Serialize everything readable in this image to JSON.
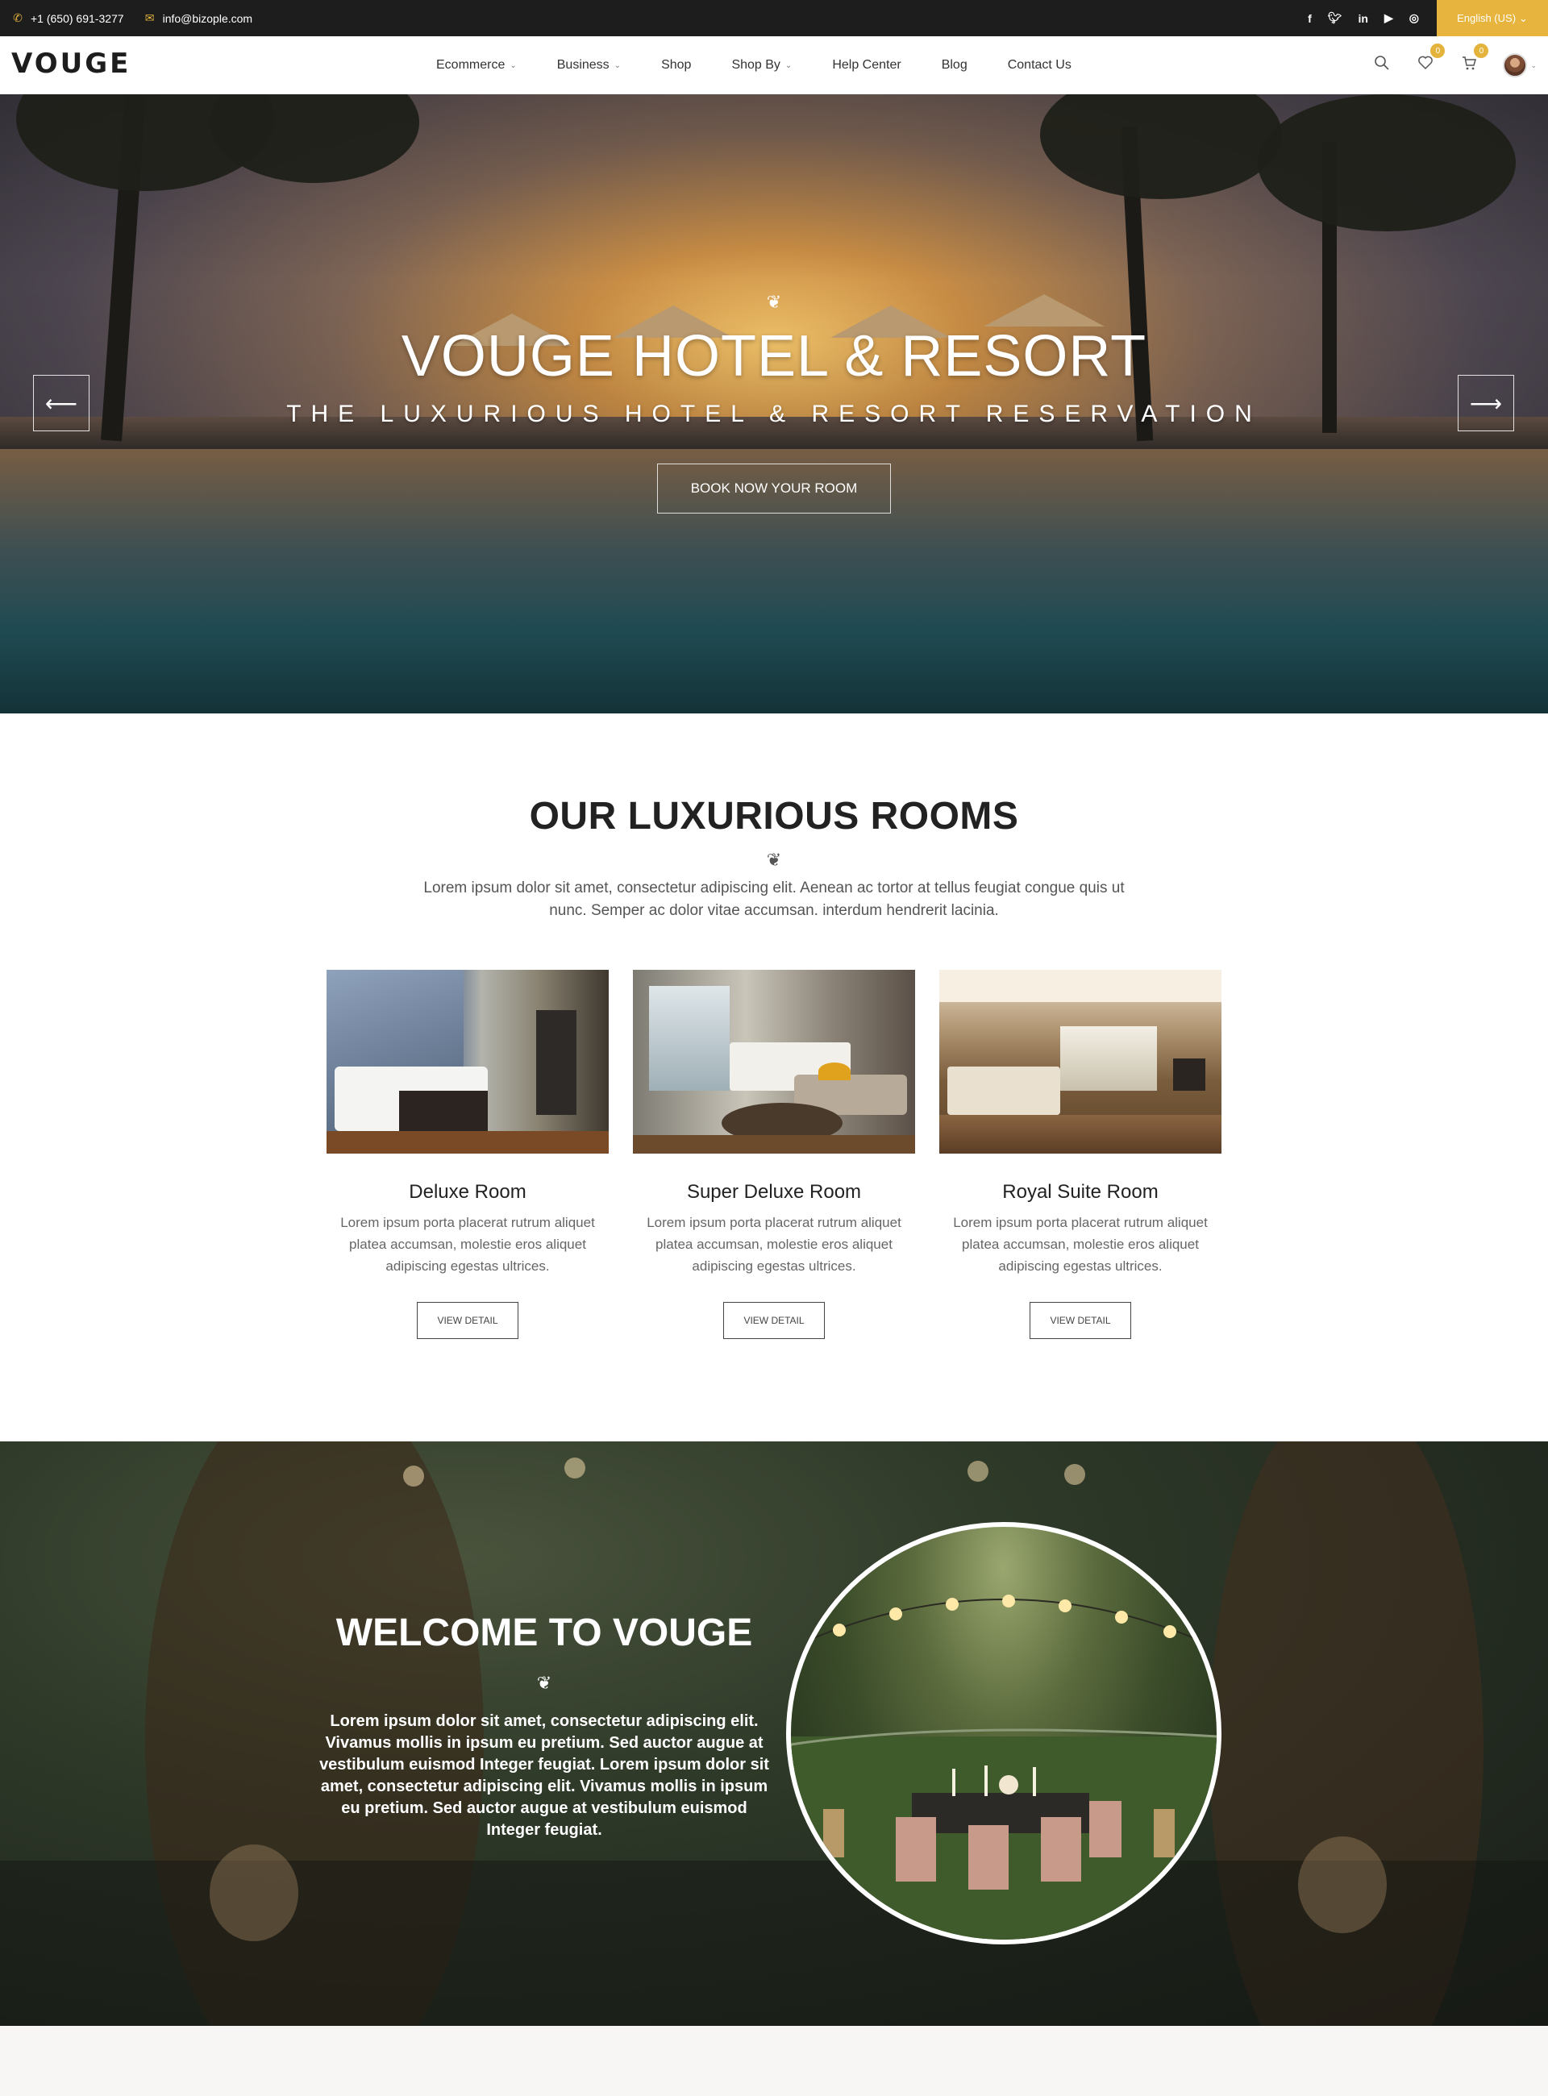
{
  "topbar": {
    "phone": "+1 (650) 691-3277",
    "email": "info@bizople.com",
    "social": [
      "facebook-icon",
      "twitter-icon",
      "linkedin-icon",
      "youtube-icon",
      "instagram-icon"
    ],
    "language": "English (US)"
  },
  "header": {
    "logo": "VOUGE",
    "nav": [
      {
        "label": "Ecommerce",
        "has_dropdown": true
      },
      {
        "label": "Business",
        "has_dropdown": true
      },
      {
        "label": "Shop",
        "has_dropdown": false
      },
      {
        "label": "Shop By",
        "has_dropdown": true
      },
      {
        "label": "Help Center",
        "has_dropdown": false
      },
      {
        "label": "Blog",
        "has_dropdown": false
      },
      {
        "label": "Contact Us",
        "has_dropdown": false
      }
    ],
    "wishlist_count": "0",
    "cart_count": "0"
  },
  "hero": {
    "title": "VOUGE HOTEL & RESORT",
    "subtitle": "THE LUXURIOUS HOTEL & RESORT RESERVATION",
    "button": "BOOK NOW YOUR ROOM"
  },
  "rooms": {
    "title": "OUR LUXURIOUS ROOMS",
    "description": "Lorem ipsum dolor sit amet, consectetur adipiscing elit. Aenean ac tortor at tellus feugiat congue quis ut nunc. Semper ac dolor vitae accumsan. interdum hendrerit lacinia.",
    "cards": [
      {
        "name": "Deluxe Room",
        "text": "Lorem ipsum porta placerat rutrum aliquet platea accumsan, molestie eros aliquet adipiscing egestas ultrices.",
        "button": "VIEW DETAIL"
      },
      {
        "name": "Super Deluxe Room",
        "text": "Lorem ipsum porta placerat rutrum aliquet platea accumsan, molestie eros aliquet adipiscing egestas ultrices.",
        "button": "VIEW DETAIL"
      },
      {
        "name": "Royal Suite Room",
        "text": "Lorem ipsum porta placerat rutrum aliquet platea accumsan, molestie eros aliquet adipiscing egestas ultrices.",
        "button": "VIEW DETAIL"
      }
    ]
  },
  "welcome": {
    "title": "WELCOME TO VOUGE",
    "text": "Lorem ipsum dolor sit amet, consectetur adipiscing elit. Vivamus mollis in ipsum eu pretium. Sed auctor augue at vestibulum euismod Integer feugiat. Lorem ipsum dolor sit amet, consectetur adipiscing elit. Vivamus mollis in ipsum eu pretium. Sed auctor augue at vestibulum euismod Integer feugiat."
  },
  "colors": {
    "accent": "#e7b53e",
    "topbar": "#1d1d1d"
  }
}
